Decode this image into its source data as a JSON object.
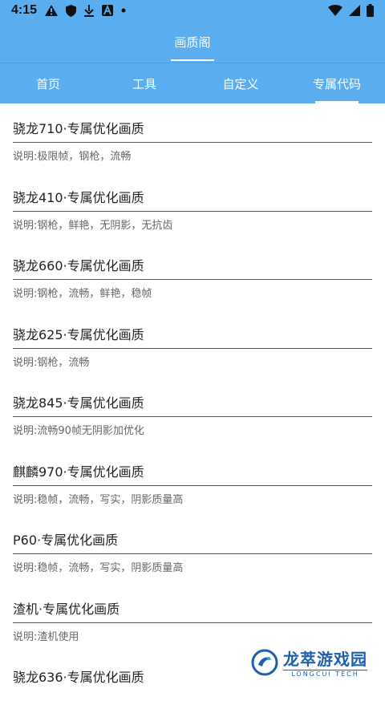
{
  "status_bar": {
    "time": "4:15",
    "icons": [
      "alert-triangle-icon",
      "shield-icon",
      "download-icon",
      "font-a-icon",
      "dot-icon"
    ],
    "right_icons": [
      "wifi-icon",
      "cellular-icon",
      "battery-icon"
    ]
  },
  "header": {
    "title": "画质阁"
  },
  "tabs": [
    {
      "label": "首页",
      "active": false
    },
    {
      "label": "工具",
      "active": false
    },
    {
      "label": "自定义",
      "active": false
    },
    {
      "label": "专属代码",
      "active": true
    }
  ],
  "items": [
    {
      "title": "骁龙710·专属优化画质",
      "desc": "说明:极限帧，钢枪，流畅"
    },
    {
      "title": "骁龙410·专属优化画质",
      "desc": "说明:钢枪，鲜艳，无阴影，无抗齿"
    },
    {
      "title": "骁龙660·专属优化画质",
      "desc": "说明:钢枪，流畅，鲜艳，稳帧"
    },
    {
      "title": "骁龙625·专属优化画质",
      "desc": "说明:钢枪，流畅"
    },
    {
      "title": "骁龙845·专属优化画质",
      "desc": "说明:流畅90帧无阴影加优化"
    },
    {
      "title": "麒麟970·专属优化画质",
      "desc": "说明:稳帧，流畅，写实，阴影质量高"
    },
    {
      "title": "P60·专属优化画质",
      "desc": "说明:稳帧，流畅，写实，阴影质量高"
    },
    {
      "title": "渣机·专属优化画质",
      "desc": "说明:渣机使用"
    },
    {
      "title": "骁龙636·专属优化画质",
      "desc": ""
    }
  ],
  "watermark": {
    "title": "龙萃游戏园",
    "subtitle": "LONGCUI TECH"
  },
  "colors": {
    "primary": "#5aaef0",
    "divider": "#555555",
    "brand": "#1d5fa8"
  }
}
